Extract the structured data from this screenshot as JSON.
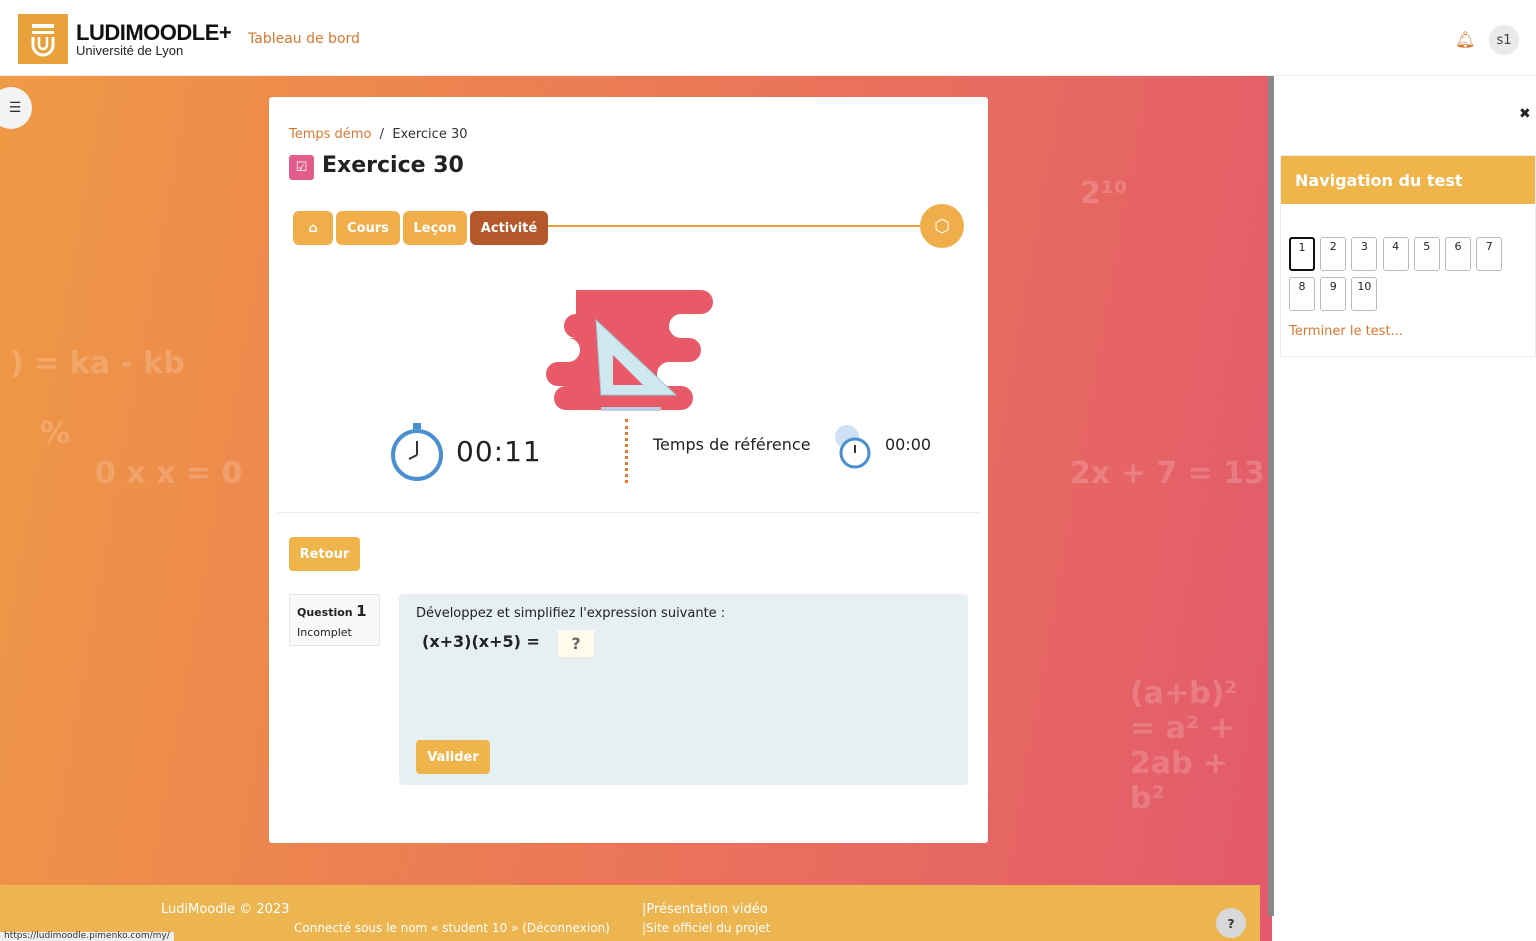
{
  "header": {
    "brand": "LUDIMOODLE+",
    "brand_sub": "Université de Lyon",
    "nav_link": "Tableau de bord",
    "avatar": "s1",
    "icons": [
      "logo-lion",
      "bell-icon"
    ]
  },
  "breadcrumb": [
    "Temps démo",
    "Exercice 30"
  ],
  "page": {
    "title": "Exercice 30"
  },
  "tabs": [
    {
      "label": "Cours"
    },
    {
      "label": "Leçon"
    },
    {
      "label": "Activité",
      "active": true
    }
  ],
  "timer": {
    "elapsed": "00:11",
    "reference_label": "Temps de référence",
    "reference": "00:00"
  },
  "buttons": {
    "back": "Retour",
    "validate": "Valider"
  },
  "question": {
    "label": "Question",
    "number": "1",
    "status": "Incomplet",
    "text": "Développez et simplifiez l'expression suivante :",
    "expression": "(x+3)(x+5) =",
    "answer": "?"
  },
  "sidebar": {
    "title": "Navigation du test",
    "questions": [
      "1",
      "2",
      "3",
      "4",
      "5",
      "6",
      "7",
      "8",
      "9",
      "10"
    ],
    "current": "1",
    "finish": "Terminer le test..."
  },
  "footer": {
    "copyright": "LudiMoodle © 2023",
    "video": "|Présentation vidéo",
    "site": "|Site officiel du projet",
    "login": "Connecté sous le nom « student 10 » (Déconnexion)",
    "help": "?"
  },
  "status_url": "https://ludimoodle.pimenko.com/my/",
  "colors": {
    "accent": "#efae4a",
    "active_tab": "#b4572a",
    "link": "#d9772f"
  }
}
